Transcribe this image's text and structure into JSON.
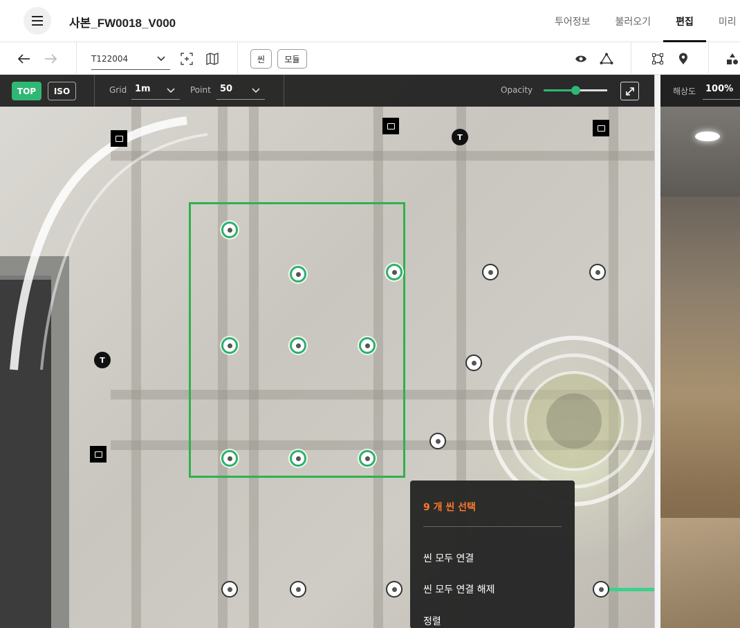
{
  "header": {
    "title": "사본_FW0018_V000",
    "tabs": [
      {
        "label": "투어정보",
        "active": false
      },
      {
        "label": "불러오기",
        "active": false
      },
      {
        "label": "편집",
        "active": true
      },
      {
        "label": "미리",
        "active": false
      }
    ]
  },
  "toolbar": {
    "scene_id": "T122004",
    "scene_button": "씬",
    "module_button": "모듈"
  },
  "viewport": {
    "view_top": "TOP",
    "view_iso": "ISO",
    "grid_label": "Grid",
    "grid_value": "1m",
    "point_label": "Point",
    "point_value": "50",
    "opacity_label": "Opacity",
    "opacity_level": 0.5,
    "marker_letter": "T"
  },
  "context_menu": {
    "title": "9 개 씬 선택",
    "items": [
      "씬 모두 연결",
      "씬 모두 연결 해제",
      "정렬"
    ]
  },
  "preview": {
    "resolution_label": "해상도",
    "resolution_value": "100%"
  },
  "colors": {
    "accent_green": "#2fb06a",
    "selection_green": "#2fb14c",
    "menu_title_orange": "#ff7a2a",
    "top_button_bg": "#2fb873"
  }
}
